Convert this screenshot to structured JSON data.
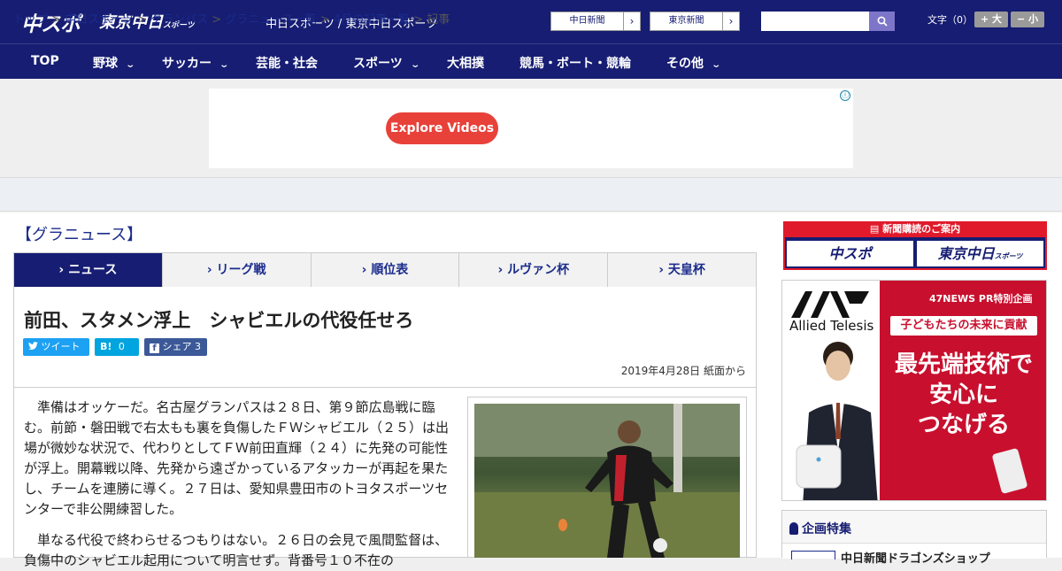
{
  "header": {
    "logo_main": "中スポ",
    "logo_sub": "東京中日",
    "logo_sub_small": "スポーツ",
    "site_name": "中日スポーツ / 東京中日スポーツ",
    "site_buttons": [
      {
        "label": "中日新聞",
        "arrow": "›"
      },
      {
        "label": "東京新聞",
        "arrow": "›"
      }
    ],
    "search_placeholder": "",
    "font_size_label": "文字（0）",
    "font_plus": "+ 大",
    "font_minus": "− 小"
  },
  "nav": [
    {
      "label": "TOP",
      "has_menu": false
    },
    {
      "label": "野球",
      "has_menu": true
    },
    {
      "label": "サッカー",
      "has_menu": true
    },
    {
      "label": "芸能・社会",
      "has_menu": false
    },
    {
      "label": "スポーツ",
      "has_menu": true
    },
    {
      "label": "大相撲",
      "has_menu": false
    },
    {
      "label": "競馬・ボート・競輪",
      "has_menu": false
    },
    {
      "label": "その他",
      "has_menu": true
    }
  ],
  "ad": {
    "button_label": "Explore Videos",
    "info_icon": "ⓘ"
  },
  "breadcrumb": [
    {
      "label": "トップ",
      "link": true
    },
    {
      "label": "中日スポーツ",
      "link": true
    },
    {
      "label": "グランパス",
      "link": true
    },
    {
      "label": "グラニュース一覧",
      "link": true
    },
    {
      "label": "4月の記事一覧",
      "link": true
    },
    {
      "label": "記事",
      "link": false
    }
  ],
  "section_title": "【グラニュース】",
  "tabs": [
    {
      "label": "ニュース",
      "active": true
    },
    {
      "label": "リーグ戦",
      "active": false
    },
    {
      "label": "順位表",
      "active": false
    },
    {
      "label": "ルヴァン杯",
      "active": false
    },
    {
      "label": "天皇杯",
      "active": false
    }
  ],
  "article": {
    "headline": "前田、スタメン浮上　シャビエルの代役任せろ",
    "share": {
      "tweet": "ツイート",
      "hatena": "0",
      "facebook": "シェア 3"
    },
    "date": "2019年4月28日 紙面から",
    "paragraphs": [
      "準備はオッケーだ。名古屋グランパスは２８日、第９節広島戦に臨む。前節・磐田戦で右太もも裏を負傷したＦＷシャビエル（２５）は出場が微妙な状況で、代わりとしてＦＷ前田直輝（２４）に先発の可能性が浮上。開幕戦以降、先発から遠ざかっているアタッカーが再起を果たし、チームを連勝に導く。２７日は、愛知県豊田市のトヨタスポーツセンターで非公開練習した。",
      "単なる代役で終わらせるつもりはない。２６日の会見で風間監督は、負傷中のシャビエル起用について明言せず。背番号１０不在の"
    ]
  },
  "sidebar": {
    "subscribe_title": "新聞購読のご案内",
    "subscribe_buttons": [
      "中スポ",
      "東京中日"
    ],
    "subscribe_small": "スポーツ",
    "promo": {
      "brand": "Allied Telesis",
      "tag": "47NEWS PR特別企画",
      "sub": "子どもたちの未来に貢献",
      "headline_lines": [
        "最先端技術で",
        "安心に",
        "つなげる"
      ]
    },
    "kikaku_title": "企画特集",
    "kikaku_item": "中日新聞ドラゴンズショップ"
  },
  "colors": {
    "navy": "#161d72",
    "red": "#e01a2a",
    "ad_red": "#e8413a",
    "link": "#1b2c8c"
  }
}
